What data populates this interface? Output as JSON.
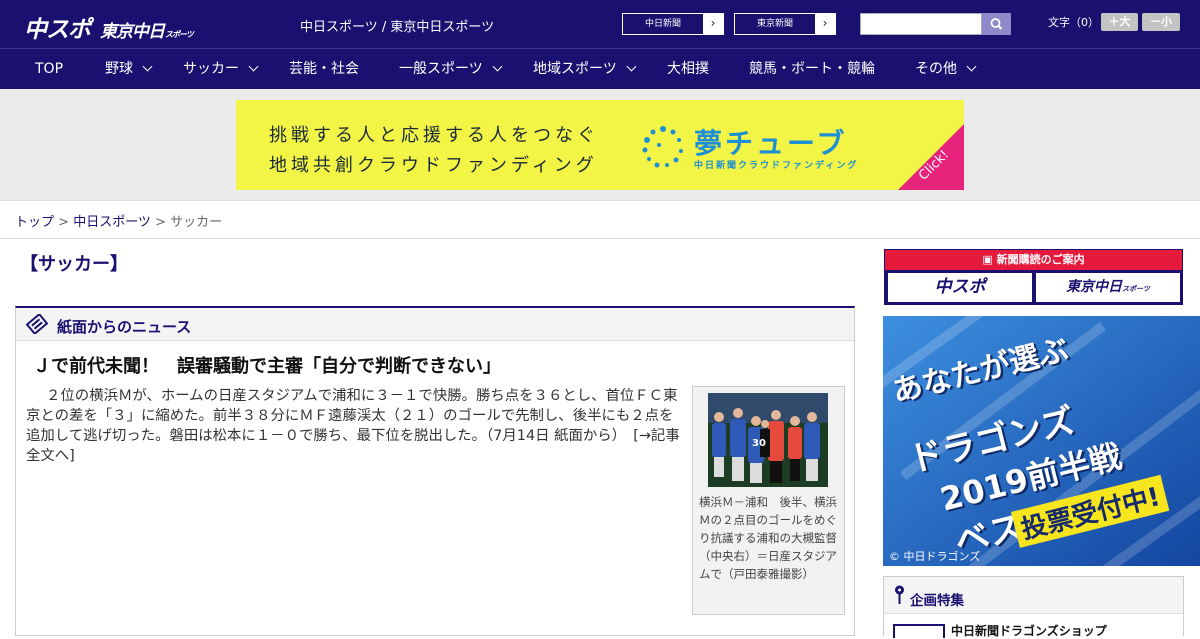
{
  "header": {
    "logo_main": "中スポ",
    "logo_tokyo": "東京中日",
    "logo_sports": "スポーツ",
    "site_title": "中日スポーツ / 東京中日スポーツ",
    "paper_buttons": [
      "中日新聞",
      "東京新聞"
    ],
    "search": {
      "placeholder": ""
    },
    "font_size_label": "文字（0）",
    "font_bigger": "＋大",
    "font_smaller": "－小"
  },
  "nav": {
    "items": [
      {
        "label": "TOP"
      },
      {
        "label": "野球"
      },
      {
        "label": "サッカー"
      },
      {
        "label": "芸能・社会"
      },
      {
        "label": "一般スポーツ"
      },
      {
        "label": "地域スポーツ"
      },
      {
        "label": "大相撲"
      },
      {
        "label": "競馬・ボート・競輪"
      },
      {
        "label": "その他"
      }
    ]
  },
  "banner": {
    "line1": "挑戦する人と応援する人をつなぐ",
    "line2": "地域共創クラウドファンディング",
    "brand": "夢チューブ",
    "brand_sub": "中日新聞クラウドファンディング",
    "click": "Click!"
  },
  "breadcrumb": {
    "items": [
      "トップ",
      "中日スポーツ",
      "サッカー"
    ],
    "sep": " > "
  },
  "main": {
    "section_title": "【サッカー】",
    "box_title": "紙面からのニュース",
    "headline": "Ｊで前代未聞！　誤審騒動で主審「自分で判断できない」",
    "body": "２位の横浜Ｍが、ホームの日産スタジアムで浦和に３－１で快勝。勝ち点を３６とし、首位ＦＣ東京との差を「３」に縮めた。前半３８分にＭＦ遠藤渓太（２１）のゴールで先制し、後半にも２点を追加して逃げ切った。磐田は松本に１－０で勝ち、最下位を脱出した。（7月14日 紙面から）",
    "more": "[→記事全文へ]",
    "caption": "横浜Ｍ－浦和　後半、横浜Ｍの２点目のゴールをめぐり抗議する浦和の大槻監督（中央右）＝日産スタジアムで（戸田泰雅撮影）",
    "photo_jersey": "30"
  },
  "sidebar": {
    "subscribe_head": "新聞購読のご案内",
    "sub_buttons": [
      "中スポ",
      "東京中日"
    ],
    "sub_small": "スポーツ",
    "ad_lines": [
      "あなたが選ぶ",
      "ドラゴンズ",
      "2019前半戦",
      "ベストシーン"
    ],
    "ad_vote": "投票受付中!",
    "ad_credit": "© 中日ドラゴンズ",
    "feature_head": "企画特集",
    "feature_item": "中日新聞ドラゴンズショップ"
  },
  "colors": {
    "brand_navy": "#1a1070",
    "banner_yellow": "#f2f446",
    "accent_red": "#e61a3d",
    "ad_blue": "#1d5fb8"
  }
}
